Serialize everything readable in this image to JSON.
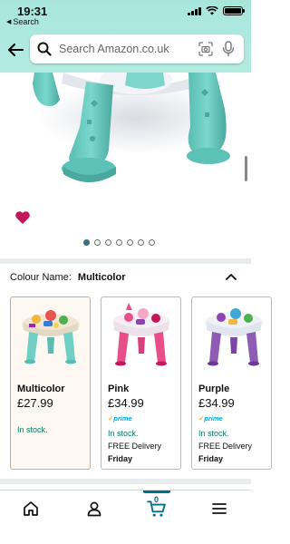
{
  "status_bar": {
    "time": "19:31",
    "back_app": "Search"
  },
  "search": {
    "placeholder": "Search Amazon.co.uk"
  },
  "gallery": {
    "dots_total": 7,
    "active_index": 0
  },
  "colour": {
    "label": "Colour Name:",
    "selected": "Multicolor"
  },
  "variants": [
    {
      "name": "Multicolor",
      "price": "£27.99",
      "prime": "",
      "stock": "In stock.",
      "delivery": "",
      "day": ""
    },
    {
      "name": "Pink",
      "price": "£34.99",
      "prime": "prime",
      "stock": "In stock.",
      "delivery": "FREE Delivery",
      "day": "Friday"
    },
    {
      "name": "Purple",
      "price": "£34.99",
      "prime": "prime",
      "stock": "In stock.",
      "delivery": "FREE Delivery",
      "day": "Friday"
    }
  ],
  "nav": {
    "cart_count": "0"
  },
  "colors": {
    "header_bg": "#a8e6dc",
    "teal_toy": "#6fcfc5",
    "selected_border": "#e7a36b",
    "in_stock": "#067d62",
    "prime_blue": "#00a8e1",
    "nav_active": "#007185"
  }
}
